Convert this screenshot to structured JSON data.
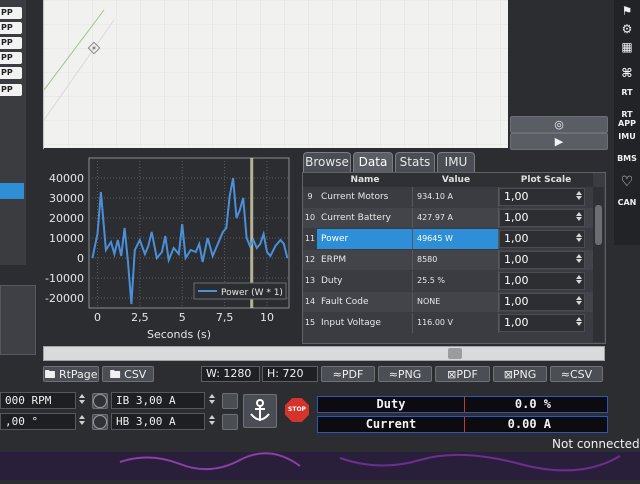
{
  "left_strip": {
    "buttons": [
      "PP",
      "PP",
      "PP",
      "PP",
      "PP",
      "PP"
    ]
  },
  "map_tools": [
    "target-icon",
    "play-icon"
  ],
  "right_icons": [
    "IO",
    "RT",
    "RT APP",
    "IMU",
    "BMS",
    "heart-icon",
    "CAN"
  ],
  "chart_data": {
    "type": "line",
    "title": "",
    "xlabel": "Seconds (s)",
    "ylabel": "",
    "xlim": [
      -0.5,
      11.3
    ],
    "ylim": [
      -25000,
      50000
    ],
    "yticks": [
      40000,
      30000,
      20000,
      10000,
      0,
      -10000,
      -20000
    ],
    "xticks": [
      0,
      2.5,
      5,
      7.5,
      10
    ],
    "xtick_labels": [
      "0",
      "2,5",
      "5",
      "7,5",
      "10"
    ],
    "grid": true,
    "legend": {
      "position": "bottom-right"
    },
    "cursor_x": 9.1,
    "series": [
      {
        "name": "Power (W * 1)",
        "color": "#4a90d9",
        "x": [
          -0.3,
          0.0,
          0.2,
          0.5,
          0.8,
          1.0,
          1.2,
          1.4,
          1.6,
          1.8,
          2.0,
          2.2,
          2.5,
          2.8,
          3.0,
          3.2,
          3.5,
          3.8,
          4.0,
          4.2,
          4.5,
          4.8,
          5.0,
          5.2,
          5.5,
          5.8,
          6.0,
          6.2,
          6.5,
          6.8,
          7.0,
          7.2,
          7.4,
          7.6,
          7.8,
          8.0,
          8.2,
          8.4,
          8.6,
          8.8,
          9.0,
          9.2,
          9.4,
          9.6,
          9.8,
          10.0,
          10.2,
          10.5,
          10.8,
          11.0,
          11.2
        ],
        "y": [
          0,
          12000,
          33000,
          4000,
          8000,
          2000,
          9000,
          1000,
          15000,
          -2000,
          -23000,
          4000,
          9000,
          2000,
          6000,
          13000,
          0,
          3000,
          11000,
          -1000,
          5000,
          2000,
          17000,
          0,
          4000,
          3000,
          7000,
          -2000,
          10000,
          1000,
          5000,
          9000,
          13000,
          15000,
          31000,
          40000,
          20000,
          24000,
          30000,
          10000,
          6000,
          9000,
          5000,
          7000,
          12000,
          3000,
          1000,
          6000,
          9000,
          7000,
          0
        ]
      }
    ]
  },
  "tabs": [
    "Browse",
    "Data",
    "Stats",
    "IMU"
  ],
  "active_tab": "Data",
  "table": {
    "headers": [
      "Name",
      "Value",
      "Plot Scale"
    ],
    "rows": [
      {
        "num": "9",
        "name": "Current Motors",
        "value": "934.10 A",
        "scale": "1,00"
      },
      {
        "num": "10",
        "name": "Current Battery",
        "value": "427.97 A",
        "scale": "1,00"
      },
      {
        "num": "11",
        "name": "Power",
        "value": "49645 W",
        "scale": "1,00"
      },
      {
        "num": "12",
        "name": "ERPM",
        "value": "8580",
        "scale": "1,00"
      },
      {
        "num": "13",
        "name": "Duty",
        "value": "25.5 %",
        "scale": "1,00"
      },
      {
        "num": "14",
        "name": "Fault Code",
        "value": "NONE",
        "scale": "1,00"
      },
      {
        "num": "15",
        "name": "Input Voltage",
        "value": "116.00 V",
        "scale": "1,00"
      }
    ],
    "selected_row": 2
  },
  "toolbar": {
    "rtpage": "RtPage",
    "csv_folder": "CSV",
    "w_label": "W: 1280",
    "h_label": "H: 720",
    "pdf1": "PDF",
    "png1": "PNG",
    "pdf2": "PDF",
    "png2": "PNG",
    "csv2": "CSV"
  },
  "controls": {
    "rpm_value": "000 RPM",
    "deg_value": ",00 °",
    "ib_value": "IB 3,00 A",
    "hb_value": "HB 3,00 A",
    "stop_label": "STOP"
  },
  "bars": [
    {
      "label": "Duty",
      "value": "0.0 %"
    },
    {
      "label": "Current",
      "value": "0.00 A"
    }
  ],
  "status": "Not connected",
  "colors": {
    "accent": "#2e8fd8",
    "line": "#4a90d9",
    "stop": "#d4342b",
    "bar_border": "#2c57b8"
  }
}
